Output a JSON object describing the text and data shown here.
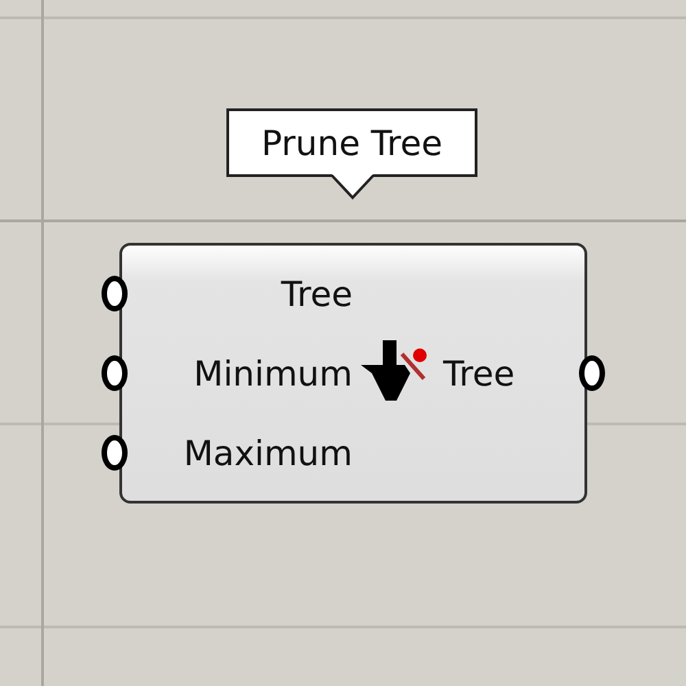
{
  "tooltip": {
    "text": "Prune Tree"
  },
  "component": {
    "inputs": [
      {
        "label": "Tree"
      },
      {
        "label": "Minimum"
      },
      {
        "label": "Maximum"
      }
    ],
    "outputs": [
      {
        "label": "Tree"
      }
    ]
  }
}
